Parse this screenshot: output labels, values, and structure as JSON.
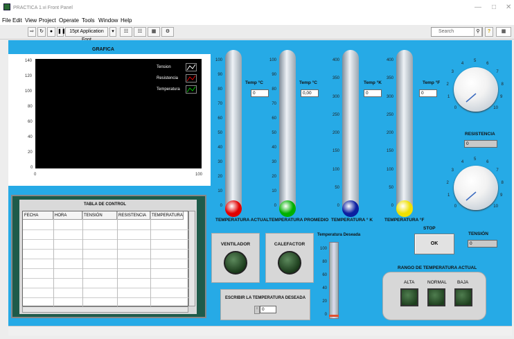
{
  "window": {
    "title": "PRACTICA 1.vi Front Panel"
  },
  "menu": [
    "File",
    "Edit",
    "View",
    "Project",
    "Operate",
    "Tools",
    "Window",
    "Help"
  ],
  "toolbar": {
    "font_label": "15pt Application Font",
    "search_placeholder": "Search"
  },
  "graph": {
    "title": "GRAFICA",
    "y_ticks": [
      "140",
      "120",
      "100",
      "80",
      "60",
      "40",
      "20",
      "0"
    ],
    "x_ticks": [
      "0",
      "100"
    ],
    "legend": [
      "Tension",
      "Resistencia",
      "Temperatura"
    ]
  },
  "table": {
    "title": "TABLA DE CONTROL",
    "columns": [
      "FECHA",
      "HORA",
      "TENSIÓN",
      "RESISTENCIA",
      "TEMPERATURA"
    ]
  },
  "thermometers": [
    {
      "label": "TEMPERATURA ACTUAL",
      "unit": "Temp °C",
      "value": "0",
      "bulb": "#e00000",
      "scale": [
        "100",
        "90",
        "80",
        "70",
        "60",
        "50",
        "40",
        "30",
        "20",
        "10",
        "0"
      ]
    },
    {
      "label": "TEMPERATURA PROMEDIO",
      "unit": "Temp °C",
      "value": "0,00",
      "bulb": "#00b000",
      "scale": [
        "100",
        "90",
        "80",
        "70",
        "60",
        "50",
        "40",
        "30",
        "20",
        "10",
        "0"
      ]
    },
    {
      "label": "TEMPERATURA ° K",
      "unit": "Temp °K",
      "value": "0",
      "bulb": "#0b1fa0",
      "scale": [
        "400",
        "350",
        "300",
        "250",
        "200",
        "150",
        "100",
        "50",
        "0"
      ]
    },
    {
      "label": "TEMPERATURA °F",
      "unit": "Temp °F",
      "value": "0",
      "bulb": "#f0e000",
      "scale": [
        "400",
        "350",
        "300",
        "250",
        "200",
        "150",
        "100",
        "50",
        "0"
      ]
    }
  ],
  "knobs": {
    "resistencia": {
      "label": "RESISTENCIA",
      "value": "0",
      "ticks": [
        "0",
        "1",
        "2",
        "3",
        "4",
        "5",
        "6",
        "7",
        "8",
        "9",
        "10"
      ]
    },
    "tension": {
      "label": "TENSIÓN",
      "value": "0",
      "ticks": [
        "0",
        "1",
        "2",
        "3",
        "4",
        "5",
        "6",
        "7",
        "8",
        "9",
        "10"
      ]
    }
  },
  "controls": {
    "ventilador": "VENTILADOR",
    "calefactor": "CALEFACTOR",
    "deseada_title": "Temperatura Deseada",
    "deseada_scale": [
      "100",
      "80",
      "60",
      "40",
      "20",
      "0"
    ],
    "escribir_label": "ESCRIBIR LA TEMPERATURA DESEADA",
    "escribir_value": "0",
    "stop_label": "STOP",
    "ok_label": "OK"
  },
  "rango": {
    "title": "RANGO DE TEMPERATURA ACTUAL",
    "labels": [
      "ALTA",
      "NORMAL",
      "BAJA"
    ]
  },
  "colors": {
    "panel": "#26aae6",
    "graph_bg": "#000000",
    "led_off": "#1b3b1b"
  }
}
